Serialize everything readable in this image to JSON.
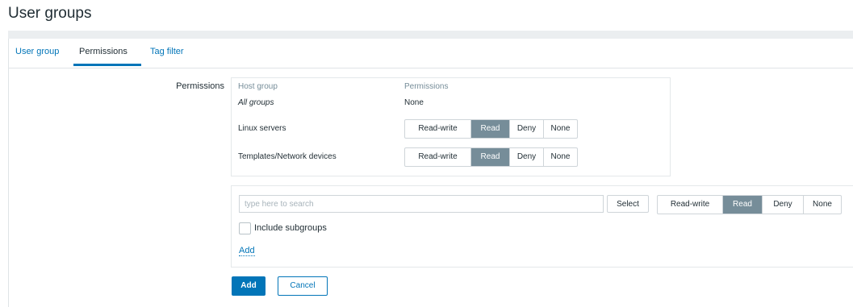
{
  "page": {
    "title": "User groups"
  },
  "tabs": [
    {
      "label": "User group",
      "active": false
    },
    {
      "label": "Permissions",
      "active": true
    },
    {
      "label": "Tag filter",
      "active": false
    }
  ],
  "form": {
    "permissions_label": "Permissions",
    "table": {
      "col_host_group": "Host group",
      "col_permissions": "Permissions",
      "rows": [
        {
          "group": "All groups",
          "permission": "None"
        },
        {
          "group": "Linux servers",
          "selected": "Read"
        },
        {
          "group": "Templates/Network devices",
          "selected": "Read"
        }
      ]
    },
    "permission_options": [
      "Read-write",
      "Read",
      "Deny",
      "None"
    ],
    "new": {
      "search_placeholder": "type here to search",
      "select_label": "Select",
      "selected": "Read",
      "include_subgroups_label": "Include subgroups",
      "include_subgroups_checked": false,
      "add_link": "Add"
    },
    "buttons": {
      "add": "Add",
      "cancel": "Cancel"
    }
  },
  "colors": {
    "accent": "#0275b8",
    "selected_segment": "#768d99",
    "header_text": "#768d99"
  }
}
